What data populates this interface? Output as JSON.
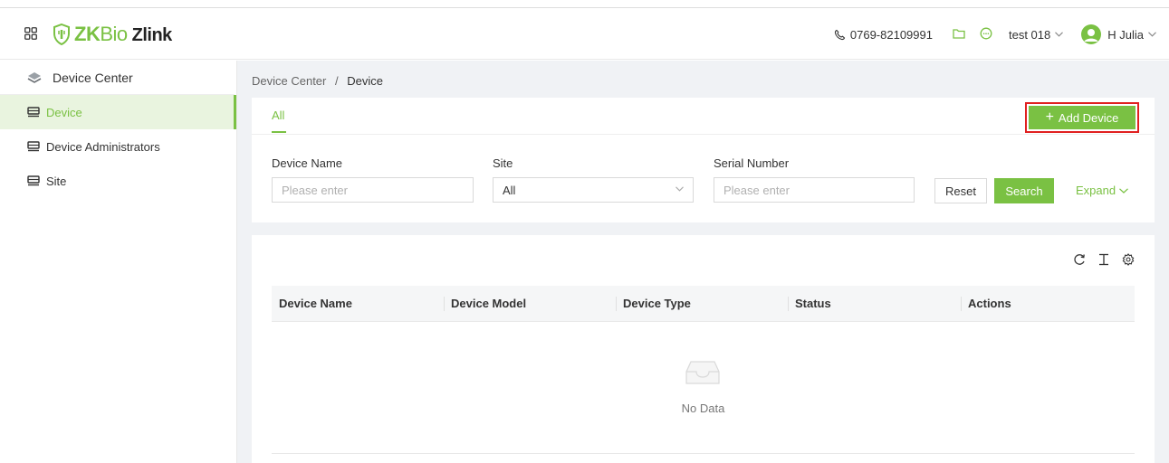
{
  "header": {
    "logo_prefix": "ZK",
    "logo_bio": "Bio",
    "logo_suffix": "Zlink",
    "phone": "0769-82109991",
    "tenant": "test 018",
    "user": "H Julia"
  },
  "sidebar": {
    "title": "Device Center",
    "items": [
      {
        "label": "Device",
        "active": true
      },
      {
        "label": "Device Administrators",
        "active": false
      },
      {
        "label": "Site",
        "active": false
      }
    ]
  },
  "breadcrumb": {
    "parent": "Device Center",
    "separator": "/",
    "current": "Device"
  },
  "tabs": {
    "all_label": "All"
  },
  "toolbar": {
    "add_device_label": "Add Device"
  },
  "filters": {
    "device_name_label": "Device Name",
    "device_name_placeholder": "Please enter",
    "site_label": "Site",
    "site_value": "All",
    "serial_label": "Serial Number",
    "serial_placeholder": "Please enter",
    "reset_label": "Reset",
    "search_label": "Search",
    "expand_label": "Expand"
  },
  "table": {
    "columns": [
      "Device Name",
      "Device Model",
      "Device Type",
      "Status",
      "Actions"
    ],
    "rows": [],
    "empty_text": "No Data"
  },
  "colors": {
    "accent": "#7ac143",
    "highlight_border": "#e02020",
    "active_bg": "#e9f4df"
  }
}
